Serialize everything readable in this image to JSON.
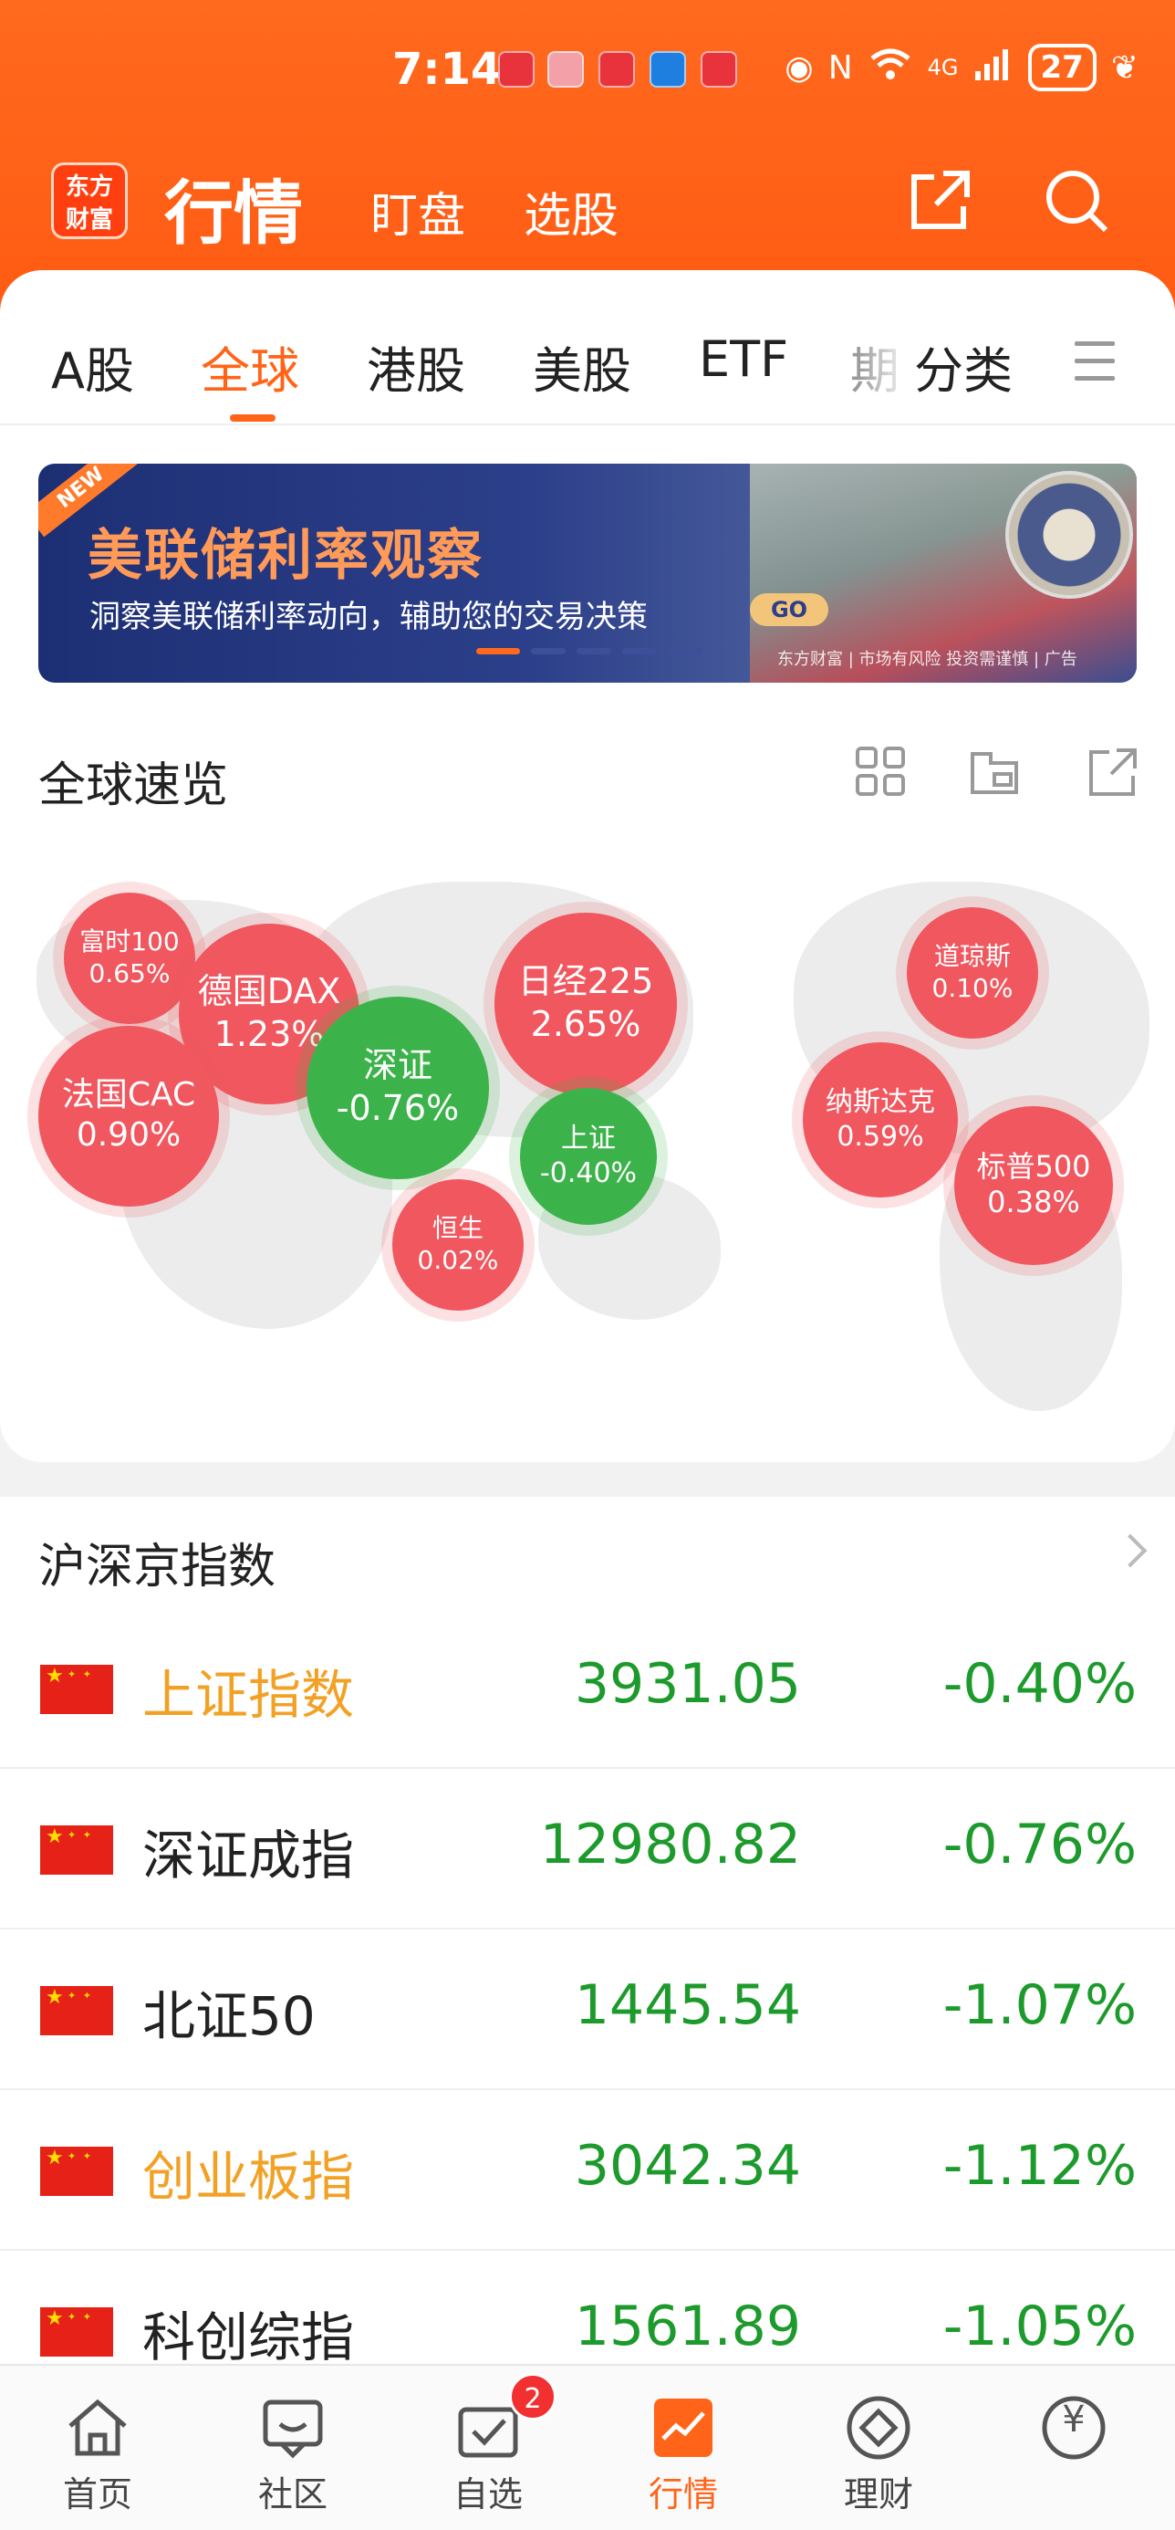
{
  "status_bar": {
    "time": "7:14",
    "signal": "4G",
    "battery": "27"
  },
  "header": {
    "logo_line1": "东方",
    "logo_line2": "财富",
    "nav": [
      "行情",
      "盯盘",
      "选股"
    ]
  },
  "tabs": [
    "A股",
    "全球",
    "港股",
    "美股",
    "ETF",
    "期",
    "分类"
  ],
  "active_tab": "全球",
  "banner": {
    "tag": "NEW",
    "title": "美联储利率观察",
    "subtitle": "洞察美联储利率动向，辅助您的交易决策",
    "go": "GO",
    "footer": "东方财富 | 市场有风险 投资需谨慎 | 广告"
  },
  "overview": {
    "title": "全球速览",
    "bubbles": [
      {
        "name": "富时100",
        "value": "0.65%",
        "dir": "up"
      },
      {
        "name": "德国DAX",
        "value": "1.23%",
        "dir": "up"
      },
      {
        "name": "法国CAC",
        "value": "0.90%",
        "dir": "up"
      },
      {
        "name": "深证",
        "value": "-0.76%",
        "dir": "down"
      },
      {
        "name": "日经225",
        "value": "2.65%",
        "dir": "up"
      },
      {
        "name": "上证",
        "value": "-0.40%",
        "dir": "down"
      },
      {
        "name": "恒生",
        "value": "0.02%",
        "dir": "up"
      },
      {
        "name": "道琼斯",
        "value": "0.10%",
        "dir": "up"
      },
      {
        "name": "纳斯达克",
        "value": "0.59%",
        "dir": "up"
      },
      {
        "name": "标普500",
        "value": "0.38%",
        "dir": "up"
      }
    ]
  },
  "indices": {
    "title": "沪深京指数",
    "rows": [
      {
        "name": "上证指数",
        "price": "3931.05",
        "change": "-0.40%",
        "highlight": true
      },
      {
        "name": "深证成指",
        "price": "12980.82",
        "change": "-0.76%",
        "highlight": false
      },
      {
        "name": "北证50",
        "price": "1445.54",
        "change": "-1.07%",
        "highlight": false
      },
      {
        "name": "创业板指",
        "price": "3042.34",
        "change": "-1.12%",
        "highlight": true
      },
      {
        "name": "科创综指",
        "price": "1561.89",
        "change": "-1.05%",
        "highlight": false
      }
    ]
  },
  "bottom_nav": {
    "items": [
      "首页",
      "社区",
      "自选",
      "行情",
      "理财",
      "¥"
    ],
    "badge": "2",
    "active": "行情"
  },
  "colors": {
    "brand": "#ff6418",
    "up": "#f0575f",
    "down": "#3cb34a",
    "price_down": "#1d9a2c"
  }
}
